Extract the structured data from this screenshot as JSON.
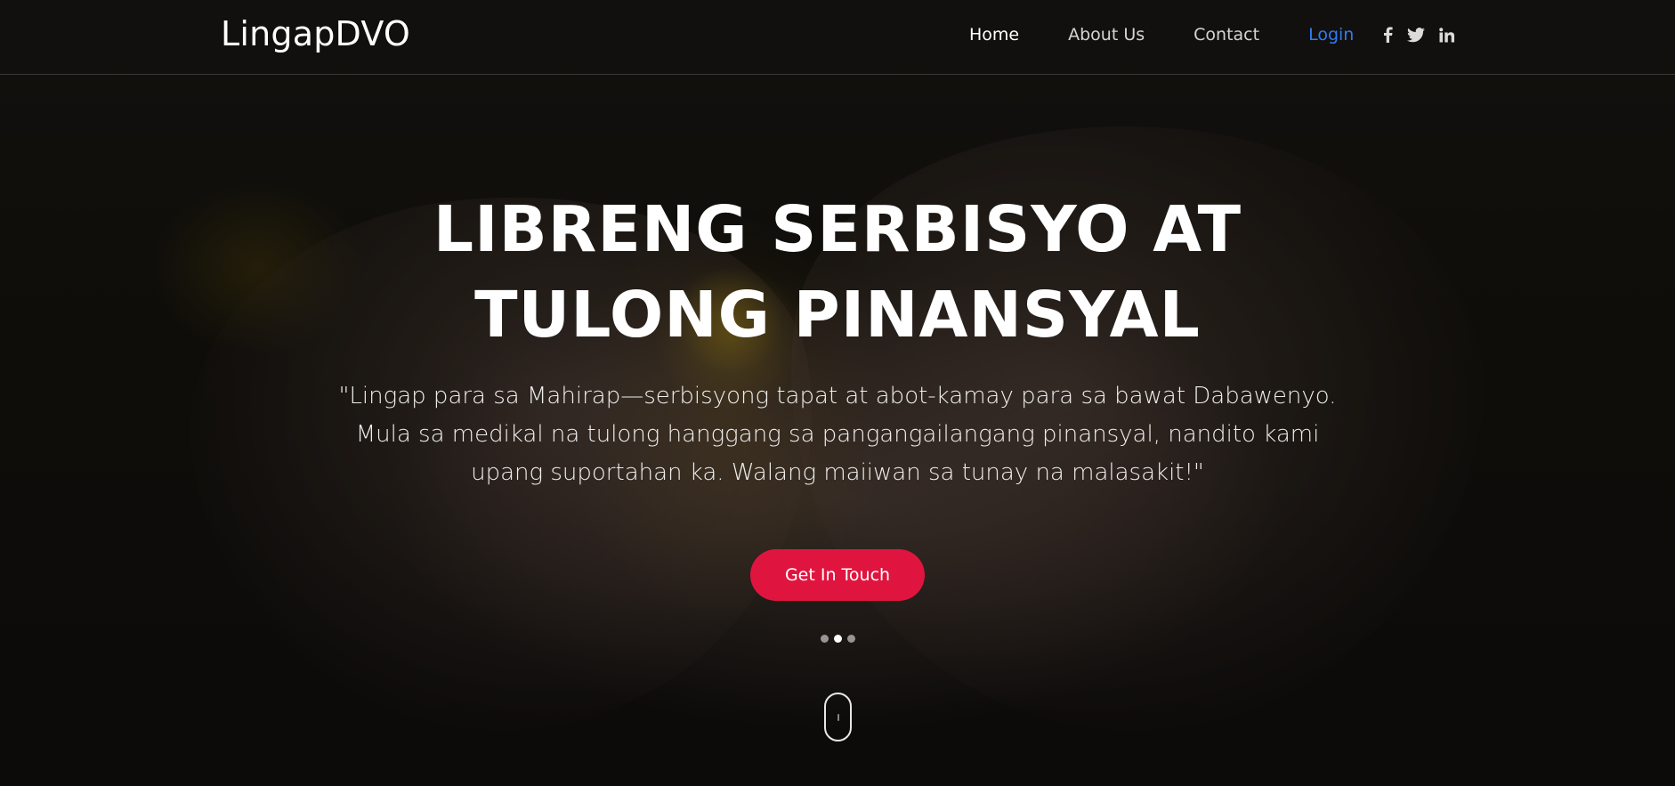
{
  "header": {
    "brand": "LingapDVO",
    "nav": [
      {
        "label": "Home",
        "active": true
      },
      {
        "label": "About Us",
        "active": false
      },
      {
        "label": "Contact",
        "active": false
      },
      {
        "label": "Login",
        "active": false
      }
    ],
    "social": [
      "facebook-icon",
      "twitter-icon",
      "linkedin-icon"
    ],
    "login_color": "#2f7bf5"
  },
  "hero": {
    "title_line1": "LIBRENG SERBISYO AT",
    "title_line2": "TULONG PINANSYAL",
    "subtitle": "\"Lingap para sa Mahirap—serbisyong tapat at abot-kamay para sa bawat Dabawenyo. Mula sa medikal na tulong hanggang sa pangangailangang pinansyal, nandito kami upang suportahan ka. Walang maiiwan sa tunay na malasakit!\"",
    "cta_label": "Get In Touch",
    "cta_color": "#e0153f",
    "carousel": {
      "slides": 3,
      "active": 2
    }
  }
}
